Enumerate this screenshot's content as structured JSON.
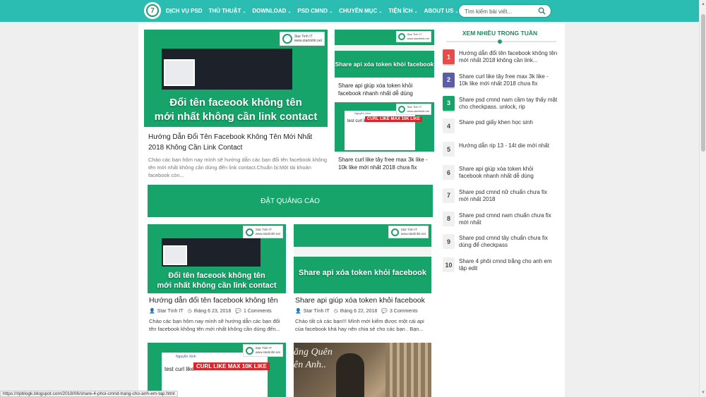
{
  "header": {
    "logo_glyph": "7",
    "nav": [
      {
        "label": "DỊCH VỤ PSD",
        "chevron": false
      },
      {
        "label": "THỦ THUẬT",
        "chevron": true
      },
      {
        "label": "DOWNLOAD",
        "chevron": true
      },
      {
        "label": "PSD CMND",
        "chevron": true
      },
      {
        "label": "CHUYÊN MỤC",
        "chevron": true
      },
      {
        "label": "TIỆN ÍCH",
        "chevron": true
      },
      {
        "label": "ABOUT US",
        "chevron": true
      }
    ],
    "search_placeholder": "Tìm kiếm bài viết..."
  },
  "watermark": {
    "line1": "Star Tinh IT",
    "line2": "www.startinhit.net"
  },
  "featured": {
    "main": {
      "thumb_caption_1": "Đổi tên faceook không tên",
      "thumb_caption_2": "mới nhất không cần link contact",
      "title": "Hướng Dẫn Đổi Tên Facebook Không Tên Mới Nhất 2018 Không Cần Link Contact",
      "excerpt": "Chào các bạn hôm nay mình sẽ hướng dẫn các bạn đổi tên facebook không tên mới nhất không cần dùng đến link contact.Chuẩn bị:Một tài khoản facebook còn..."
    },
    "side1": {
      "thumb_caption": "Share api xóa token khỏi facebook",
      "title": "Share api giúp xóa token khỏi facebook nhanh nhất dễ dùng"
    },
    "side2": {
      "thumb_name": "Nguyễn Xinh",
      "thumb_post": "test curl like",
      "thumb_caption": "CURL LIKE MAX 10K LIKE",
      "title": "Share curl like tây free max 3k like - 10k like mới nhất 2018 chưa fix"
    }
  },
  "ad": {
    "label": "ĐẶT QUẢNG CÁO"
  },
  "posts": [
    {
      "thumb_caption_1": "Đổi tên faceook không tên",
      "thumb_caption_2": "mới nhất không cần link contact",
      "title": "Hướng dẫn đổi tên facebook không tên",
      "author": "Star Tính IT",
      "date": "tháng 6 23, 2018",
      "comments": "1 Comments",
      "excerpt": "Chào các bạn hôm nay mình sẽ hướng dẫn các bạn đổi tên facebook không tên mới nhất không cần dùng đến..."
    },
    {
      "thumb_caption_1": "Share api xóa token khỏi facebook",
      "title": "Share api giúp xóa token khỏi facebook",
      "author": "Star Tính IT",
      "date": "tháng 6 22, 2018",
      "comments": "3 Comments",
      "excerpt": "Chào tất cả các bạn!!! Mình mới kiếm được một cái api của facebook khá hay nên chia sẻ cho các bạn . Bạn..."
    },
    {
      "thumb_name": "Nguyễn Xinh",
      "thumb_post": "test curl like",
      "thumb_caption_1": "CURL LIKE MAX 10K LIKE"
    },
    {
      "thumb_caption_1": "ăng Quên",
      "thumb_caption_2": "ên Anh.."
    }
  ],
  "sidebar": {
    "title": "XEM NHIỀU TRONG TUẦN",
    "items": [
      {
        "rank": "1",
        "color": "#e74c4c",
        "text": "Hướng dẫn đổi tên facebook không tên mới nhất 2018 không cần link..."
      },
      {
        "rank": "2",
        "color": "#5b5ea6",
        "text": "Share curl like tây free max 3k like - 10k like mới nhất 2018 chưa fix"
      },
      {
        "rank": "3",
        "color": "#16a46a",
        "text": "Share psd cmnd nam cầm tay thấy mặt cho checkpass. unlock, rip"
      },
      {
        "rank": "4",
        "color": "#f0f0f0",
        "text": "Share psd giấy khen học sinh"
      },
      {
        "rank": "5",
        "color": "#f0f0f0",
        "text": "Hướng dẫn rip 13 - 14t die mới nhất"
      },
      {
        "rank": "6",
        "color": "#f0f0f0",
        "text": "Share api giúp xóa token khỏi facebook nhanh nhất dễ dùng"
      },
      {
        "rank": "7",
        "color": "#f0f0f0",
        "text": "Share psd cmnd nữ chuẩn chưa fix mới nhất 2018"
      },
      {
        "rank": "8",
        "color": "#f0f0f0",
        "text": "Share psd cmnd nam chuẩn chưa fix mới nhất"
      },
      {
        "rank": "9",
        "color": "#f0f0f0",
        "text": "Share psd cmnd tây chuẩn chưa fix dùng để checkpass"
      },
      {
        "rank": "10",
        "color": "#f0f0f0",
        "text": "Share 4 phôi cmnd trắng cho anh em tập edit"
      }
    ]
  },
  "statusbar": {
    "url": "https://ripblogk.blogspot.com/2018/06/share-4-phoi-cmnd-trang-cho-anh-em-tap.html"
  },
  "colors": {
    "topbar": "#2bbdb1",
    "brand_green": "#16a46a"
  }
}
